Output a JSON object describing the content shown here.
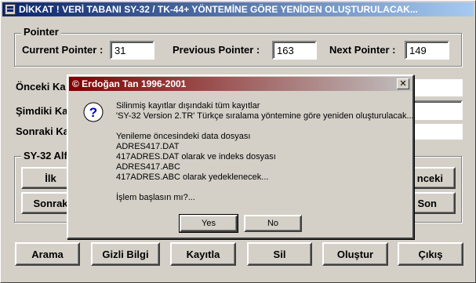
{
  "window": {
    "title": "DİKKAT ! VERİ TABANI SY-32 / TK-44+ YÖNTEMİNE GÖRE YENİDEN OLUŞTURULACAK..."
  },
  "pointer_group": {
    "title": "Pointer",
    "current_label": "Current Pointer :",
    "current_value": "31",
    "previous_label": "Previous Pointer :",
    "previous_value": "163",
    "next_label": "Next Pointer :",
    "next_value": "149"
  },
  "rows": {
    "onceki_label": "Önceki Ka",
    "simdiki_label": "Şimdiki Ka",
    "sonraki_label": "Sonraki Ka"
  },
  "alfa_group": {
    "title": "SY-32 Alf",
    "ilk_label": "İlk",
    "sonraki_label": "Sonrak",
    "onceki_label": "nceki",
    "son_label": "Son"
  },
  "bottom_buttons": [
    "Arama",
    "Gizli Bilgi",
    "Kayıtla",
    "Sil",
    "Oluştur",
    "Çıkış"
  ],
  "dialog": {
    "title": "© Erdoğan Tan  1996-2001",
    "close_glyph": "✕",
    "lines": [
      "Silinmiş kayıtlar dışındaki tüm kayıtlar",
      "'SY-32 Version 2.TR' Türkçe sıralama yöntemine göre yeniden oluşturulacak...",
      "",
      "Yenileme öncesindeki data dosyası",
      "ADRES417.DAT",
      "417ADRES.DAT olarak ve indeks dosyası",
      "ADRES417.ABC",
      "417ADRES.ABC olarak yedeklenecek...",
      "",
      "İşlem başlasın mı?..."
    ],
    "yes_label": "Yes",
    "no_label": "No",
    "icon": "question-icon"
  }
}
